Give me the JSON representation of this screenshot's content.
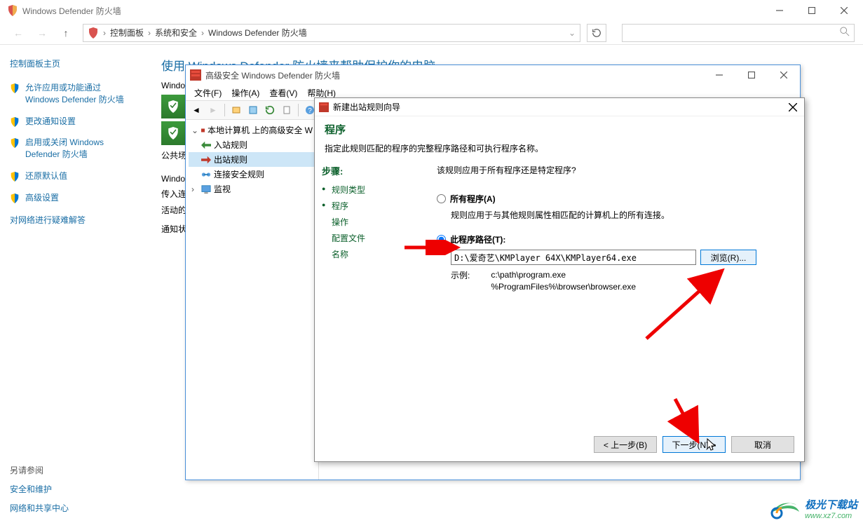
{
  "cp": {
    "title": "Windows Defender 防火墙",
    "breadcrumb": {
      "cp": "控制面板",
      "sec": "系统和安全",
      "fw": "Windows Defender 防火墙"
    },
    "sidebar": {
      "home": "控制面板主页",
      "allow": "允许应用或功能通过 Windows Defender 防火墙",
      "notify": "更改通知设置",
      "onoff": "启用或关闭 Windows Defender 防火墙",
      "restore": "还原默认值",
      "adv": "高级设置",
      "trouble": "对网络进行疑难解答",
      "see_also": "另请参阅",
      "sec_maint": "安全和维护",
      "net_share": "网络和共享中心"
    },
    "main": {
      "title": "使用 Windows Defender 防火墙来帮助保护你的电脑",
      "desc": "Windows",
      "private_label": "公共场",
      "windows_row": "Windo",
      "in_conn": "传入连",
      "active": "活动的",
      "notify_state": "通知状"
    }
  },
  "fw": {
    "title": "高级安全 Windows Defender 防火墙",
    "menu": {
      "file": "文件(F)",
      "action": "操作(A)",
      "view": "查看(V)",
      "help": "帮助(H)"
    },
    "tree": {
      "root": "本地计算机 上的高级安全 W",
      "inbound": "入站规则",
      "outbound": "出站规则",
      "connsec": "连接安全规则",
      "monitor": "监视"
    }
  },
  "wiz": {
    "title": "新建出站规则向导",
    "header_title": "程序",
    "header_desc": "指定此规则匹配的程序的完整程序路径和可执行程序名称。",
    "steps": {
      "hdr": "步骤:",
      "type": "规则类型",
      "program": "程序",
      "action": "操作",
      "profile": "配置文件",
      "name": "名称"
    },
    "question": "该规则应用于所有程序还是特定程序?",
    "opt_all": "所有程序(A)",
    "opt_all_desc": "规则应用于与其他规则属性相匹配的计算机上的所有连接。",
    "opt_path": "此程序路径(T):",
    "path_value": "D:\\爱奇艺\\KMPlayer 64X\\KMPlayer64.exe",
    "browse": "浏览(R)...",
    "example_label": "示例:",
    "example_path1": "c:\\path\\program.exe",
    "example_path2": "%ProgramFiles%\\browser\\browser.exe",
    "back": "< 上一步(B)",
    "next": "下一步(N) >",
    "cancel": "取消"
  },
  "watermark": {
    "text": "极光下载站",
    "url": "www.xz7.com"
  }
}
